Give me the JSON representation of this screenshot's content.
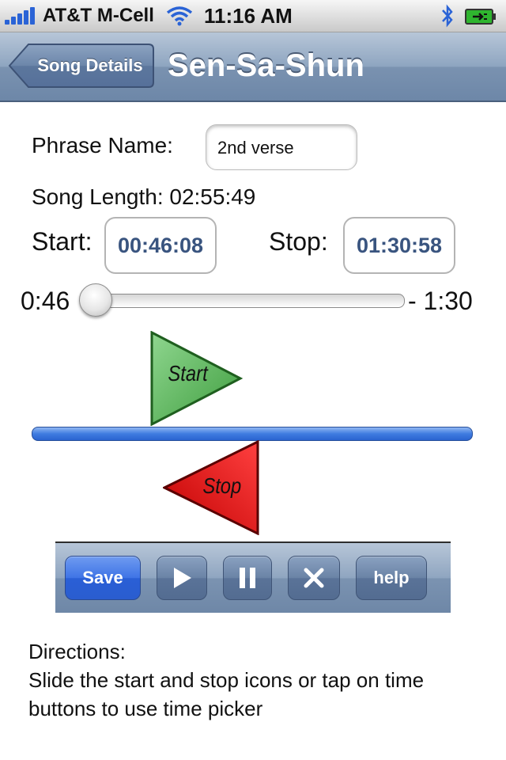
{
  "status_bar": {
    "carrier": "AT&T M-Cell",
    "time": "11:16 AM"
  },
  "nav": {
    "back_label": "Song Details",
    "title": "Sen-Sa-Shun"
  },
  "form": {
    "phrase_label": "Phrase Name:",
    "phrase_value": "2nd verse",
    "song_length": "Song Length: 02:55:49",
    "start_label": "Start:",
    "start_value": "00:46:08",
    "stop_label": "Stop:",
    "stop_value": "01:30:58"
  },
  "slider": {
    "min_label": "0:46",
    "max_label": "- 1:30",
    "position": 0.0
  },
  "markers": {
    "start_label": "Start",
    "start_color": "#4caf50",
    "stop_label": "Stop",
    "stop_color": "#e00000"
  },
  "toolbar": {
    "save_label": "Save",
    "play_icon": "play-icon",
    "pause_icon": "pause-icon",
    "close_icon": "close-icon",
    "help_label": "help"
  },
  "directions": {
    "heading": "Directions:",
    "line1": "Slide the start and stop icons or tap on time",
    "line2": "buttons to use time picker"
  },
  "colors": {
    "accent": "#2a63d6",
    "time_text": "#39547f"
  }
}
